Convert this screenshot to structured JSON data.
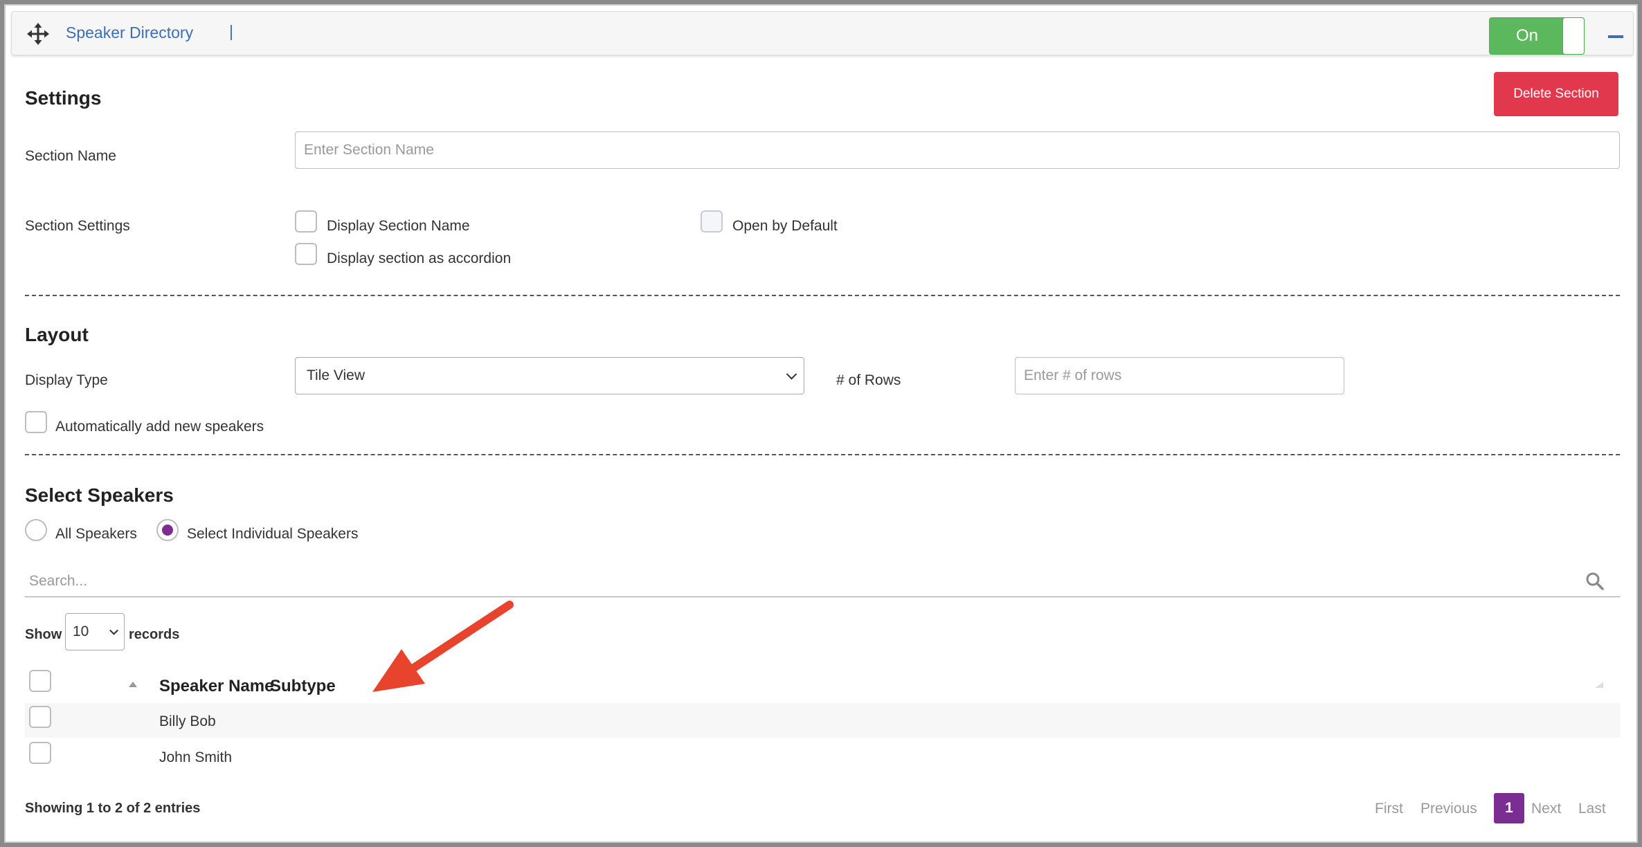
{
  "header": {
    "title": "Speaker Directory",
    "separator": "|",
    "toggle_label": "On",
    "move_icon": "move-icon",
    "collapse_icon": "minus-icon"
  },
  "settings": {
    "heading": "Settings",
    "delete_label": "Delete Section",
    "section_name_label": "Section Name",
    "section_name_placeholder": "Enter Section Name",
    "section_settings_label": "Section Settings",
    "display_section_name": "Display Section Name",
    "open_by_default": "Open by Default",
    "display_as_accordion": "Display section as accordion"
  },
  "layout": {
    "heading": "Layout",
    "display_type_label": "Display Type",
    "display_type_value": "Tile View",
    "rows_label": "# of Rows",
    "rows_placeholder": "Enter # of rows",
    "auto_add_label": "Automatically add new speakers"
  },
  "speakers": {
    "heading": "Select Speakers",
    "all_label": "All Speakers",
    "individual_label": "Select Individual Speakers",
    "selected_option": "individual",
    "search_placeholder": "Search...",
    "show_label": "Show",
    "records_value": "10",
    "records_label": "records",
    "columns": [
      "Speaker Name",
      "Subtype"
    ],
    "rows": [
      {
        "name": "Billy Bob"
      },
      {
        "name": "John Smith"
      }
    ],
    "showing_text": "Showing 1 to 2 of 2 entries",
    "pagination": {
      "first": "First",
      "previous": "Previous",
      "current": "1",
      "next": "Next",
      "last": "Last"
    }
  },
  "colors": {
    "accent_blue": "#3a6fb5",
    "toggle_green": "#5cb85c",
    "delete_red": "#e2384d",
    "radio_purple": "#7b2d91",
    "annotation_arrow": "#e8432d"
  }
}
